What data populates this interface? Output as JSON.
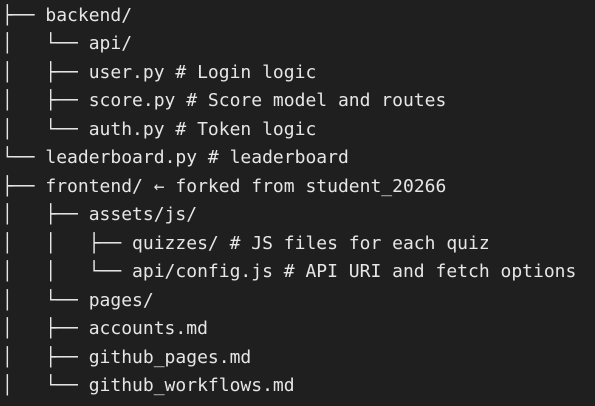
{
  "tree": {
    "lines": [
      {
        "prefix": "├── ",
        "text": "backend/"
      },
      {
        "prefix": "│   └── ",
        "text": "api/"
      },
      {
        "prefix": "│   ├── ",
        "text": "user.py # Login logic"
      },
      {
        "prefix": "│   ├── ",
        "text": "score.py # Score model and routes"
      },
      {
        "prefix": "│   └── ",
        "text": "auth.py # Token logic"
      },
      {
        "prefix": "└── ",
        "text": "leaderboard.py # leaderboard"
      },
      {
        "prefix": "├── ",
        "text": "frontend/ ← forked from student_20266"
      },
      {
        "prefix": "│   ├── ",
        "text": "assets/js/"
      },
      {
        "prefix": "│   │   ├── ",
        "text": "quizzes/ # JS files for each quiz"
      },
      {
        "prefix": "│   │   └── ",
        "text": "api/config.js # API URI and fetch options"
      },
      {
        "prefix": "│   └── ",
        "text": "pages/"
      },
      {
        "prefix": "│   ├── ",
        "text": "accounts.md"
      },
      {
        "prefix": "│   ├── ",
        "text": "github_pages.md"
      },
      {
        "prefix": "│   └── ",
        "text": "github_workflows.md"
      }
    ]
  }
}
